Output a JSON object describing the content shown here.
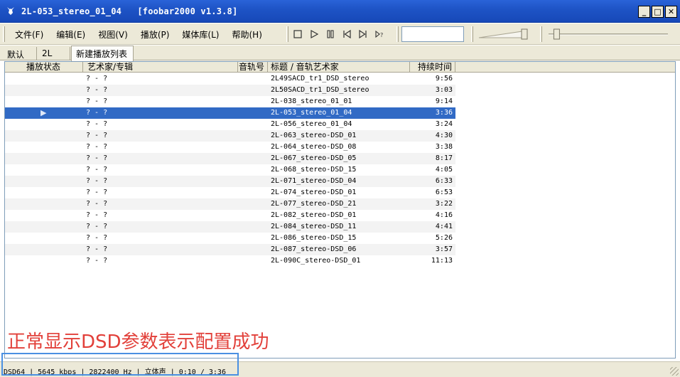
{
  "window": {
    "title": "2L-053_stereo_01_04   [foobar2000 v1.3.8]",
    "minimize": "_",
    "maximize": "□",
    "close": "✕"
  },
  "menu": [
    "文件(F)",
    "编辑(E)",
    "视图(V)",
    "播放(P)",
    "媒体库(L)",
    "帮助(H)"
  ],
  "transport": [
    "stop-icon",
    "play-icon",
    "pause-icon",
    "previous-icon",
    "next-icon",
    "random-icon"
  ],
  "tabs": [
    {
      "label": "默认",
      "active": false
    },
    {
      "label": "2L",
      "active": false
    },
    {
      "label": "新建播放列表",
      "active": true
    }
  ],
  "columns": [
    "播放状态",
    "艺术家/专辑",
    "音轨号",
    "标题 / 音轨艺术家",
    "持续时间"
  ],
  "rows": [
    {
      "artist": "? - ?",
      "track": "",
      "title": "2L49SACD_tr1_DSD_stereo",
      "duration": "9:56",
      "playing": false
    },
    {
      "artist": "? - ?",
      "track": "",
      "title": "2L50SACD_tr1_DSD_stereo",
      "duration": "3:03",
      "playing": false
    },
    {
      "artist": "? - ?",
      "track": "",
      "title": "2L-038_stereo_01_01",
      "duration": "9:14",
      "playing": false
    },
    {
      "artist": "? - ?",
      "track": "",
      "title": "2L-053_stereo_01_04",
      "duration": "3:36",
      "playing": true
    },
    {
      "artist": "? - ?",
      "track": "",
      "title": "2L-056_stereo_01_04",
      "duration": "3:24",
      "playing": false
    },
    {
      "artist": "? - ?",
      "track": "",
      "title": "2L-063_stereo-DSD_01",
      "duration": "4:30",
      "playing": false
    },
    {
      "artist": "? - ?",
      "track": "",
      "title": "2L-064_stereo-DSD_08",
      "duration": "3:38",
      "playing": false
    },
    {
      "artist": "? - ?",
      "track": "",
      "title": "2L-067_stereo-DSD_05",
      "duration": "8:17",
      "playing": false
    },
    {
      "artist": "? - ?",
      "track": "",
      "title": "2L-068_stereo-DSD_15",
      "duration": "4:05",
      "playing": false
    },
    {
      "artist": "? - ?",
      "track": "",
      "title": "2L-071_stereo-DSD_04",
      "duration": "6:33",
      "playing": false
    },
    {
      "artist": "? - ?",
      "track": "",
      "title": "2L-074_stereo-DSD_01",
      "duration": "6:53",
      "playing": false
    },
    {
      "artist": "? - ?",
      "track": "",
      "title": "2L-077_stereo-DSD_21",
      "duration": "3:22",
      "playing": false
    },
    {
      "artist": "? - ?",
      "track": "",
      "title": "2L-082_stereo-DSD_01",
      "duration": "4:16",
      "playing": false
    },
    {
      "artist": "? - ?",
      "track": "",
      "title": "2L-084_stereo-DSD_11",
      "duration": "4:41",
      "playing": false
    },
    {
      "artist": "? - ?",
      "track": "",
      "title": "2L-086_stereo-DSD_15",
      "duration": "5:26",
      "playing": false
    },
    {
      "artist": "? - ?",
      "track": "",
      "title": "2L-087_stereo-DSD_06",
      "duration": "3:57",
      "playing": false
    },
    {
      "artist": "? - ?",
      "track": "",
      "title": "2L-090C_stereo-DSD_01",
      "duration": "11:13",
      "playing": false
    }
  ],
  "annotation": "正常显示DSD参数表示配置成功",
  "status": "DSD64 | 5645 kbps | 2822400 Hz | 立体声 | 0:10 / 3:36",
  "volume_level": 1.0,
  "seek_position": 0.046,
  "colors": {
    "titlebar": "#1e54c6",
    "selection": "#316ac5",
    "annotation": "#e2403a",
    "annotation_box": "#4a90e2"
  }
}
